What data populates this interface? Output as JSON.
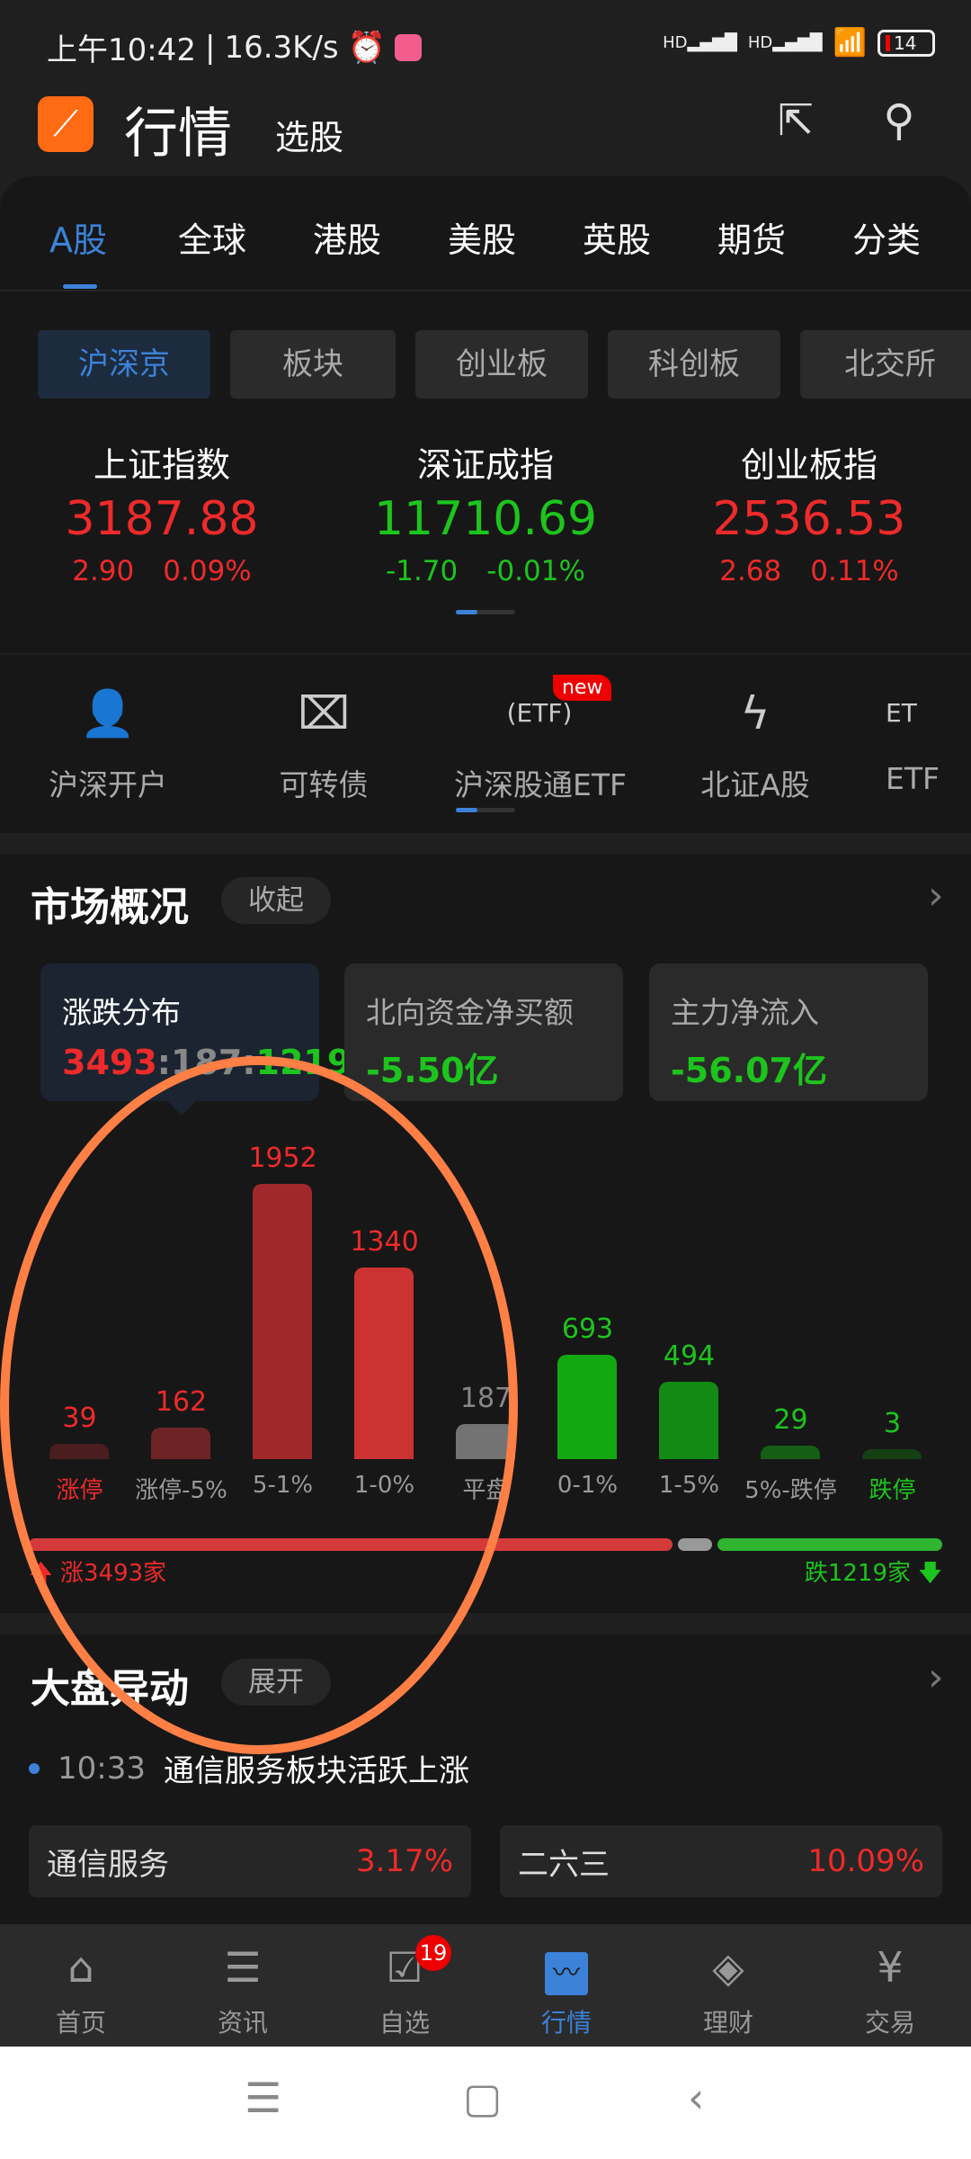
{
  "status_bar": {
    "time": "上午10:42",
    "speed": "16.3K/s",
    "battery": "14"
  },
  "header": {
    "title": "行情",
    "subtitle": "选股"
  },
  "tabs": [
    "A股",
    "全球",
    "港股",
    "美股",
    "英股",
    "期货",
    "分类"
  ],
  "chips": [
    "沪深京",
    "板块",
    "创业板",
    "科创板",
    "北交所"
  ],
  "indices": [
    {
      "name": "上证指数",
      "value": "3187.88",
      "change": "2.90",
      "pct": "0.09%",
      "dir": "up"
    },
    {
      "name": "深证成指",
      "value": "11710.69",
      "change": "-1.70",
      "pct": "-0.01%",
      "dir": "down"
    },
    {
      "name": "创业板指",
      "value": "2536.53",
      "change": "2.68",
      "pct": "0.11%",
      "dir": "up"
    }
  ],
  "quick": [
    {
      "label": "沪深开户",
      "icon": "user-plus-icon"
    },
    {
      "label": "可转债",
      "icon": "ticket-icon"
    },
    {
      "label": "沪深股通ETF",
      "icon": "etf-exchange-icon",
      "badge": "new"
    },
    {
      "label": "北证A股",
      "icon": "lightning-icon"
    },
    {
      "label": "ETF",
      "icon": "etf-icon"
    }
  ],
  "market": {
    "title": "市场概况",
    "toggle": "收起",
    "cards": [
      {
        "title": "涨跌分布",
        "up": "3493",
        "flat": "187",
        "down": "1219"
      },
      {
        "title": "北向资金净买额",
        "value": "-5.50亿"
      },
      {
        "title": "主力净流入",
        "value": "-56.07亿"
      }
    ],
    "up_label": "涨3493家",
    "down_label": "跌1219家"
  },
  "chart_data": {
    "type": "bar",
    "categories": [
      "涨停",
      "涨停-5%",
      "5-1%",
      "1-0%",
      "平盘",
      "0-1%",
      "1-5%",
      "5%-跌停",
      "跌停"
    ],
    "values": [
      39,
      162,
      1952,
      1340,
      187,
      693,
      494,
      29,
      3
    ],
    "colors": [
      "#4a1e1e",
      "#6e2424",
      "#a0282b",
      "#cc3232",
      "#737373",
      "#12a812",
      "#138a13",
      "#155e15",
      "#144014"
    ],
    "label_colors": [
      "#ee2a2a",
      "#ee2a2a",
      "#ee2a2a",
      "#ee2a2a",
      "#888888",
      "#1dc41d",
      "#1dc41d",
      "#1dc41d",
      "#1dc41d"
    ],
    "split": {
      "up": 3493,
      "flat": 187,
      "down": 1219
    }
  },
  "news": {
    "title": "大盘异动",
    "toggle": "展开",
    "time": "10:33",
    "headline": "通信服务板块活跃上涨",
    "tags": [
      {
        "name": "通信服务",
        "pct": "3.17%"
      },
      {
        "name": "二六三",
        "pct": "10.09%"
      }
    ]
  },
  "nav": [
    {
      "label": "首页",
      "icon": "home-icon"
    },
    {
      "label": "资讯",
      "icon": "news-icon"
    },
    {
      "label": "自选",
      "icon": "watchlist-icon",
      "badge": "19"
    },
    {
      "label": "行情",
      "icon": "market-chart-icon",
      "active": true
    },
    {
      "label": "理财",
      "icon": "wealth-icon"
    },
    {
      "label": "交易",
      "icon": "trade-yen-icon"
    }
  ],
  "colors": {
    "accent": "#3c82d8",
    "up": "#ee2a2a",
    "down": "#1dc41d",
    "annotation": "#ff7f45"
  }
}
